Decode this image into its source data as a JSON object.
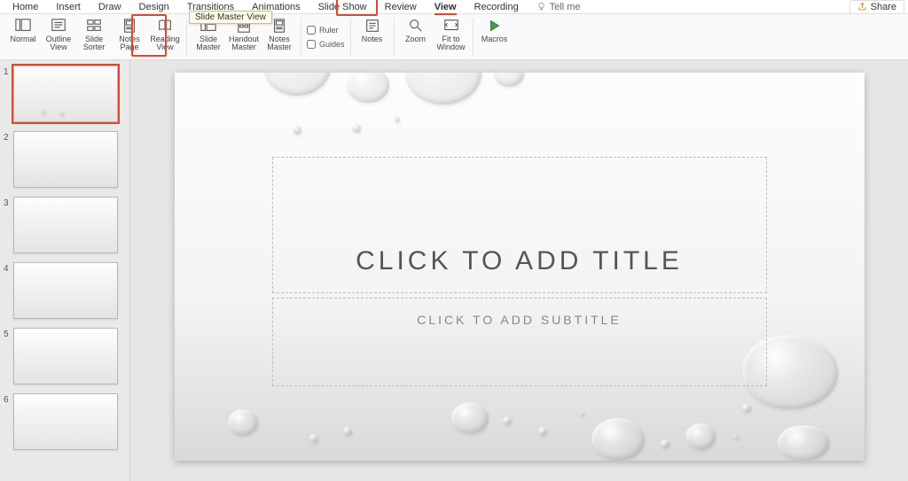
{
  "tabs": {
    "home": "Home",
    "insert": "Insert",
    "draw": "Draw",
    "design": "Design",
    "transitions": "Transitions",
    "animations": "Animations",
    "slideshow": "Slide Show",
    "review": "Review",
    "view": "View",
    "recording": "Recording",
    "tellme": "Tell me"
  },
  "share": "Share",
  "ribbon": {
    "normal": "Normal",
    "outline": "Outline View",
    "sorter": "Slide Sorter",
    "notespage": "Notes Page",
    "reading": "Reading View",
    "slidemaster": "Slide Master",
    "handoutmaster": "Handout Master",
    "notesmaster": "Notes Master",
    "ruler": "Ruler",
    "guides": "Guides",
    "notes": "Notes",
    "zoom": "Zoom",
    "fit": "Fit to Window",
    "macros": "Macros",
    "tooltip": "Slide Master View"
  },
  "slide": {
    "title_placeholder": "CLICK TO ADD TITLE",
    "subtitle_placeholder": "CLICK TO ADD SUBTITLE"
  },
  "thumbs": {
    "count": 6,
    "n1": "1",
    "n2": "2",
    "n3": "3",
    "n4": "4",
    "n5": "5",
    "n6": "6"
  },
  "colors": {
    "accent": "#d64b2f"
  }
}
